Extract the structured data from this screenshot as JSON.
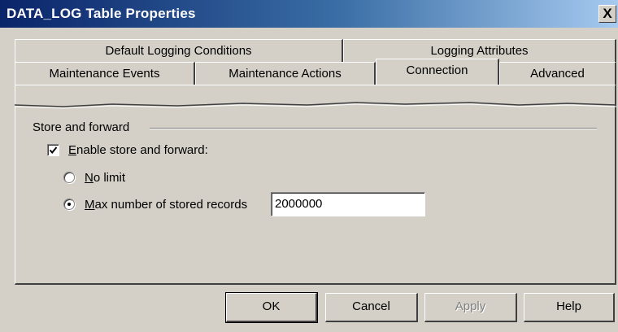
{
  "window": {
    "title": "DATA_LOG Table Properties",
    "close_glyph": "X"
  },
  "tabs": {
    "row1": [
      {
        "label": "Default Logging Conditions"
      },
      {
        "label": "Logging Attributes"
      }
    ],
    "row2": [
      {
        "label": "Maintenance Events"
      },
      {
        "label": "Maintenance Actions"
      },
      {
        "label": "Connection",
        "active": true
      },
      {
        "label": "Advanced"
      }
    ]
  },
  "store_forward": {
    "group_label": "Store and forward",
    "enable_checkbox": {
      "label_prefix": "",
      "label_accel": "E",
      "label_rest": "nable store and forward:",
      "checked": true
    },
    "no_limit": {
      "label_accel": "N",
      "label_rest": "o limit",
      "selected": false
    },
    "max_records": {
      "label_accel": "M",
      "label_rest": "ax number of stored records",
      "selected": true,
      "value": "2000000"
    }
  },
  "buttons": {
    "ok": "OK",
    "cancel": "Cancel",
    "apply": "Apply",
    "help": "Help"
  },
  "icons": {
    "close": "close-icon",
    "check": "checkmark-icon"
  },
  "colors": {
    "title_gradient_start": "#0a246a",
    "title_gradient_end": "#a6caf0",
    "face": "#d4d0c8"
  }
}
